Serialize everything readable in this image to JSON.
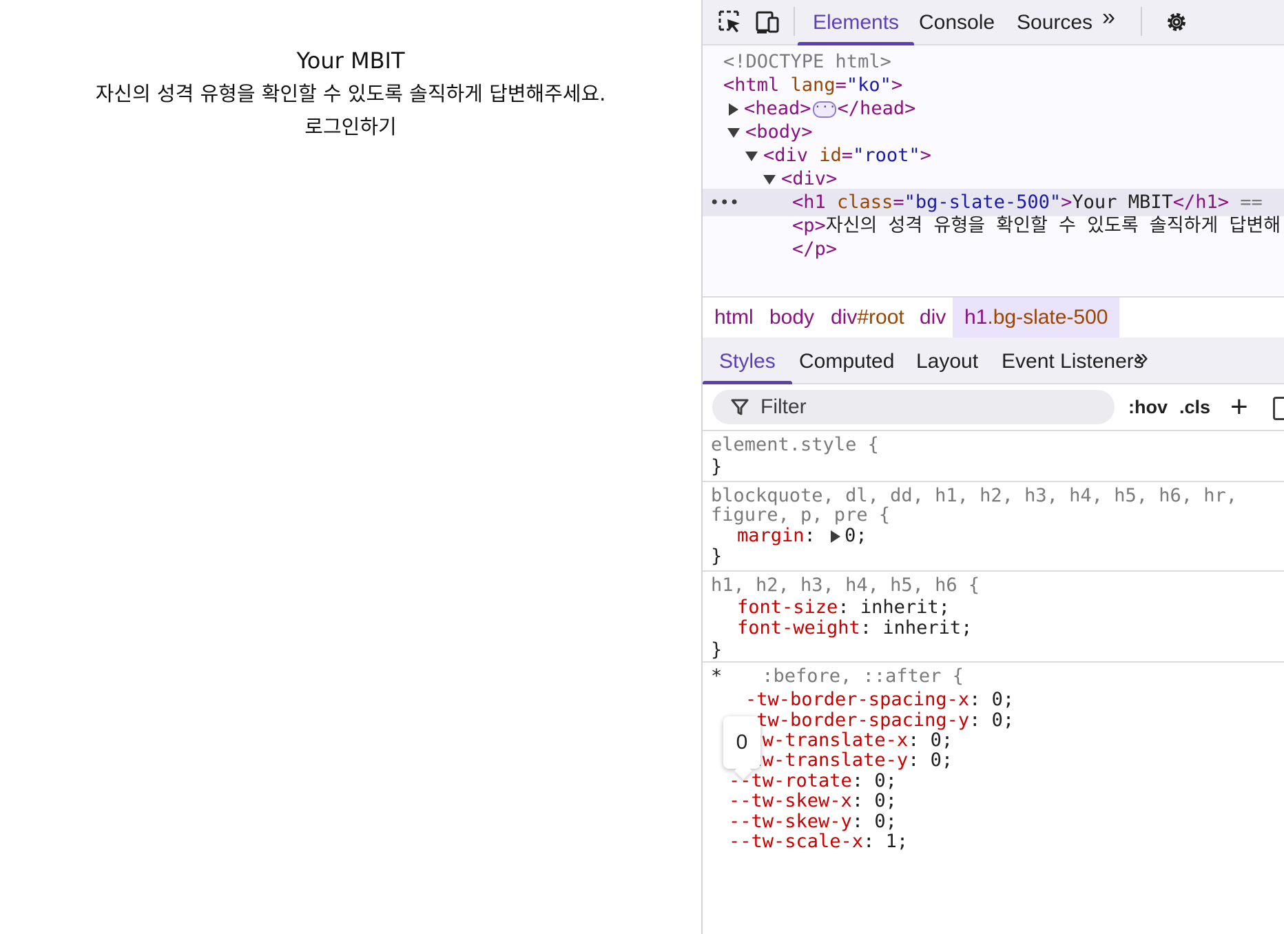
{
  "page": {
    "title": "Your MBIT",
    "description": "자신의 성격 유형을 확인할 수 있도록 솔직하게 답변해주세요.",
    "login_link": "로그인하기"
  },
  "devtools": {
    "main_tabs": [
      "Elements",
      "Console",
      "Sources"
    ],
    "more_tabs": "»",
    "dom": {
      "doctype": "<!DOCTYPE html>",
      "html_open": "<html ",
      "html_attr": "lang",
      "html_val": "\"ko\"",
      "head_open": "<head>",
      "head_close": "</head>",
      "body_open": "<body>",
      "div_root_open": "<div ",
      "div_root_attr": "id",
      "div_root_val": "\"root\"",
      "div_open": "<div>",
      "h1_open": "<h1 ",
      "h1_attr": "class",
      "h1_val": "\"bg-slate-500\"",
      "h1_text": "Your MBIT",
      "h1_close": "</h1>",
      "h1_eq": " ==",
      "p_open": "<p>",
      "p_text": "자신의 성격 유형을 확인할 수 있도록 솔직하게 답변해",
      "p_close": "</p>",
      "gt": ">",
      "eq": "=",
      "ellipsis": "···"
    },
    "breadcrumbs": [
      {
        "tag": "html",
        "id": ""
      },
      {
        "tag": "body",
        "id": ""
      },
      {
        "tag": "div",
        "id": "#root"
      },
      {
        "tag": "div",
        "id": ""
      },
      {
        "tag": "h1",
        "id": ".bg-slate-500"
      }
    ],
    "sub_tabs": [
      "Styles",
      "Computed",
      "Layout",
      "Event Listeners"
    ],
    "filter_placeholder": "Filter",
    "hov": ":hov",
    "cls": ".cls",
    "plus": "+",
    "rules": {
      "element_style": "element.style {",
      "close_brace": "}",
      "r2_sel_line1": "blockquote, dl, dd, h1, h2, h3, h4, h5, h6, hr,",
      "r2_sel_line2": "figure, p, pre {",
      "r2_prop": "margin",
      "r2_val": "0;",
      "r3_sel": "h1, h2, h3, h4, h5, h6 {",
      "r3_p1": "font-size",
      "r3_v1": "inherit;",
      "r3_p2": "font-weight",
      "r3_v2": "inherit;",
      "r4_sel_star": "*",
      "r4_sel_rest": ":before, ::after {",
      "r4_props": [
        {
          "p": "-tw-border-spacing-x",
          "v": "0;"
        },
        {
          "p": "-tw-border-spacing-y",
          "v": "0;"
        },
        {
          "p": "--tw-translate-x",
          "v": "0;"
        },
        {
          "p": "--tw-translate-y",
          "v": "0;"
        },
        {
          "p": "--tw-rotate",
          "v": "0;"
        },
        {
          "p": "--tw-skew-x",
          "v": "0;"
        },
        {
          "p": "--tw-skew-y",
          "v": "0;"
        },
        {
          "p": "--tw-scale-x",
          "v": "1;"
        }
      ]
    },
    "tooltip": "0"
  }
}
